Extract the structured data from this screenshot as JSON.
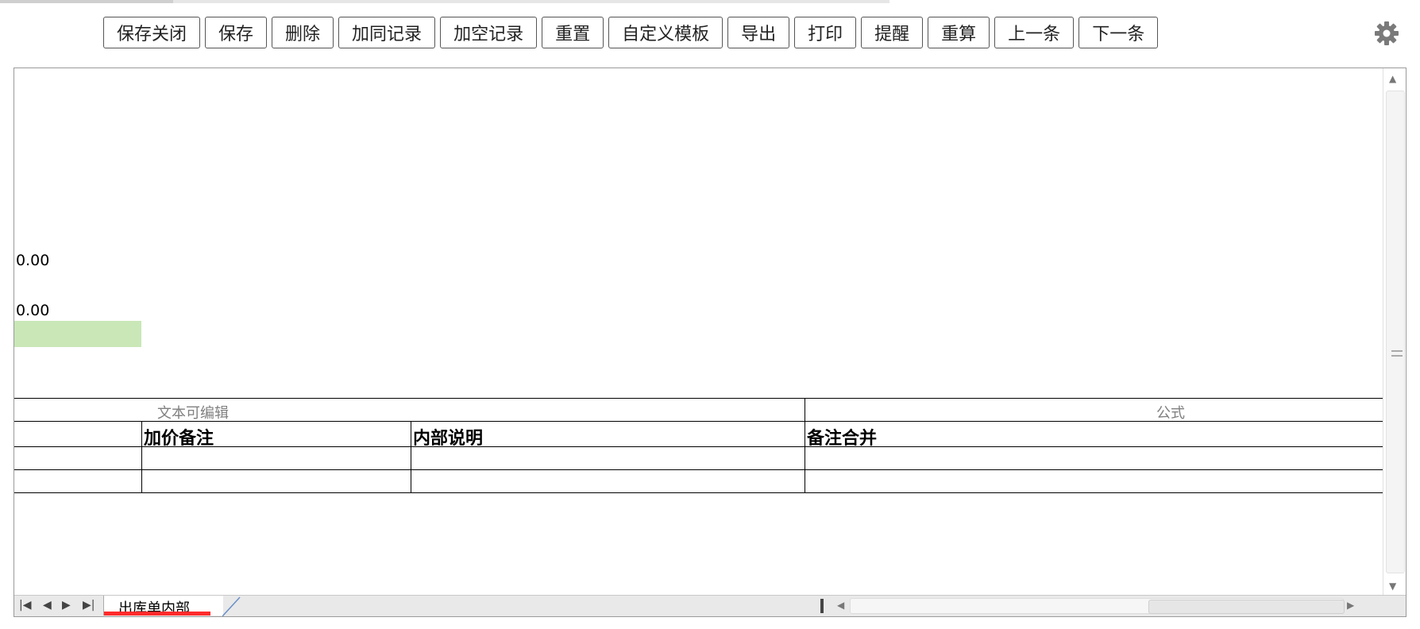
{
  "toolbar": {
    "buttons": [
      "保存关闭",
      "保存",
      "删除",
      "加同记录",
      "加空记录",
      "重置",
      "自定义模板",
      "导出",
      "打印",
      "提醒",
      "重算",
      "上一条",
      "下一条"
    ]
  },
  "sheet": {
    "value1": "0.00",
    "value2": "0.00",
    "group_header_left": "文本可编辑",
    "group_header_right": "公式",
    "columns": [
      "",
      "加价备注",
      "内部说明",
      "备注合并"
    ],
    "rows": [
      [
        "",
        "",
        "",
        ""
      ],
      [
        "",
        "",
        "",
        ""
      ]
    ],
    "highlight_color": "#c9e7b7"
  },
  "tabs": {
    "active": "出库单内部",
    "active_color": "#ff2b2b"
  }
}
